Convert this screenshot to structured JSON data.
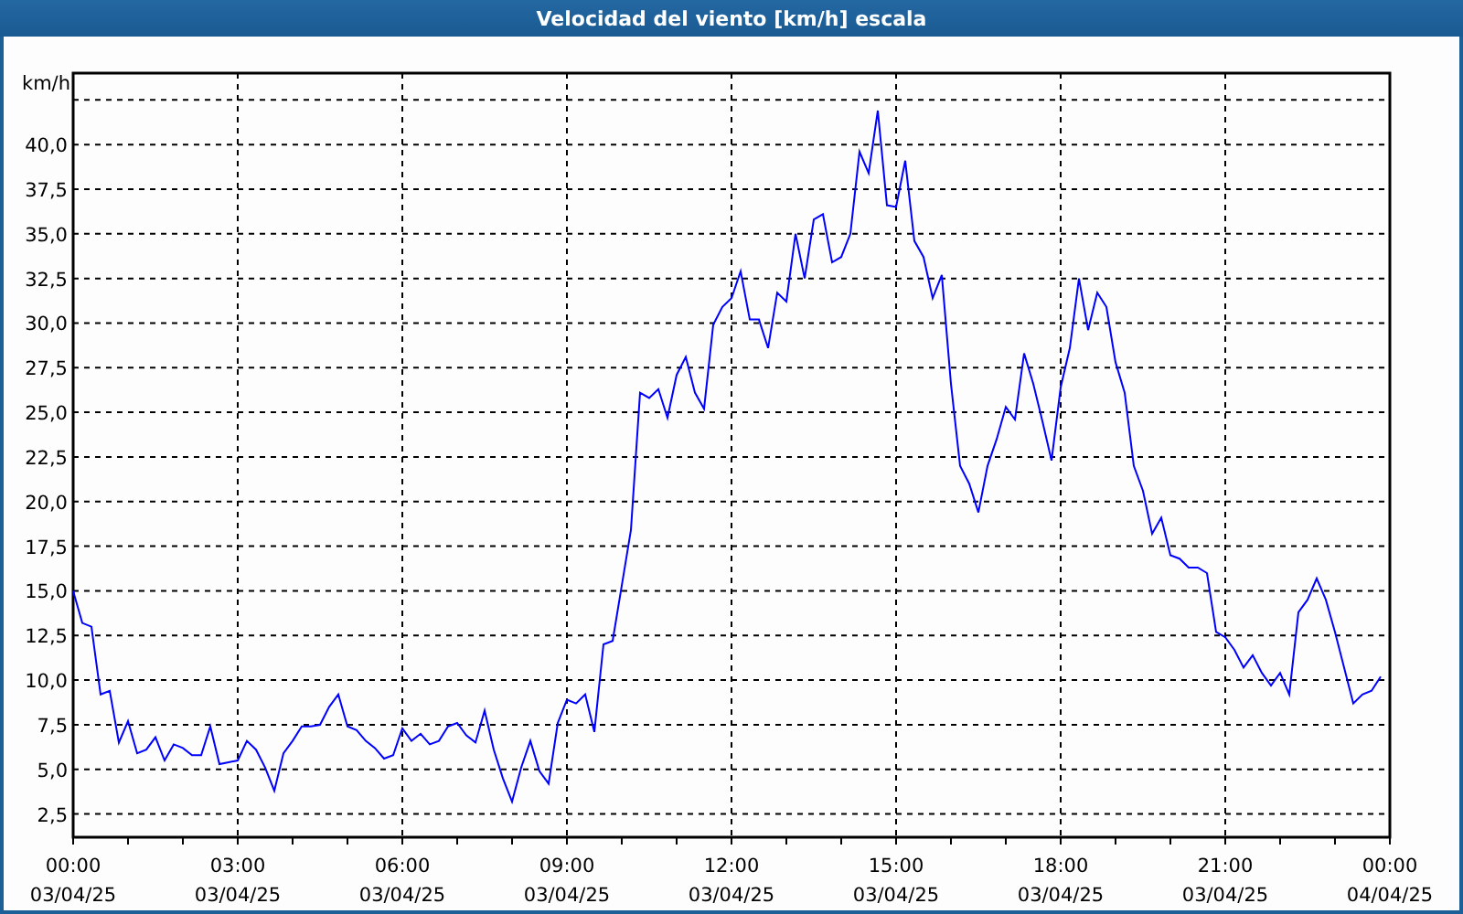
{
  "chart": {
    "chart_data": {
      "type": "line",
      "title": "Velocidad del viento [km/h] escala",
      "ylabel": "km/h",
      "grid": true,
      "ylim": [
        1.2,
        44
      ],
      "categories": [
        "00:00 03/04/25",
        null,
        null,
        null,
        null,
        null,
        null,
        null,
        null,
        null,
        null,
        null,
        null,
        null,
        null,
        null,
        null,
        null,
        "03:00 03/04/25",
        null,
        null,
        null,
        null,
        null,
        null,
        null,
        null,
        null,
        null,
        null,
        null,
        null,
        null,
        null,
        null,
        null,
        "06:00 03/04/25",
        null,
        null,
        null,
        null,
        null,
        null,
        null,
        null,
        null,
        null,
        null,
        null,
        null,
        null,
        null,
        null,
        null,
        "09:00 03/04/25",
        null,
        null,
        null,
        null,
        null,
        null,
        null,
        null,
        null,
        null,
        null,
        null,
        null,
        null,
        null,
        null,
        null,
        "12:00 03/04/25",
        null,
        null,
        null,
        null,
        null,
        null,
        null,
        null,
        null,
        null,
        null,
        null,
        null,
        null,
        null,
        null,
        null,
        "15:00 03/04/25",
        null,
        null,
        null,
        null,
        null,
        null,
        null,
        null,
        null,
        null,
        null,
        null,
        null,
        null,
        null,
        null,
        null,
        "18:00 03/04/25",
        null,
        null,
        null,
        null,
        null,
        null,
        null,
        null,
        null,
        null,
        null,
        null,
        null,
        null,
        null,
        null,
        null,
        "21:00 03/04/25",
        null,
        null,
        null,
        null,
        null,
        null,
        null,
        null,
        null,
        null,
        null,
        null,
        null,
        null,
        null,
        null,
        null,
        "00:00 04/04/25"
      ],
      "yticks": [
        {
          "value": 2.5,
          "label": "2,5"
        },
        {
          "value": 5,
          "label": "5,0"
        },
        {
          "value": 7.5,
          "label": "7,5"
        },
        {
          "value": 10,
          "label": "10,0"
        },
        {
          "value": 12.5,
          "label": "12,5"
        },
        {
          "value": 15,
          "label": "15,0"
        },
        {
          "value": 17.5,
          "label": "17,5"
        },
        {
          "value": 20,
          "label": "20,0"
        },
        {
          "value": 22.5,
          "label": "22,5"
        },
        {
          "value": 25,
          "label": "25,0"
        },
        {
          "value": 27.5,
          "label": "27,5"
        },
        {
          "value": 30,
          "label": "30,0"
        },
        {
          "value": 32.5,
          "label": "32,5"
        },
        {
          "value": 35,
          "label": "35,0"
        },
        {
          "value": 37.5,
          "label": "37,5"
        },
        {
          "value": 40,
          "label": "40,0"
        }
      ],
      "series": [
        {
          "color": "#0000ff",
          "values": [
            15.0,
            13.2,
            13.0,
            9.2,
            9.4,
            6.5,
            7.7,
            5.9,
            6.1,
            6.8,
            5.5,
            6.4,
            6.2,
            5.8,
            5.8,
            7.4,
            5.3,
            5.4,
            5.5,
            6.6,
            6.1,
            5.1,
            3.8,
            5.9,
            6.6,
            7.4,
            7.4,
            7.5,
            8.5,
            9.2,
            7.4,
            7.2,
            6.6,
            6.2,
            5.6,
            5.8,
            7.3,
            6.6,
            7.0,
            6.4,
            6.6,
            7.4,
            7.6,
            6.9,
            6.5,
            8.3,
            6.1,
            4.5,
            3.2,
            5.1,
            6.6,
            4.9,
            4.2,
            7.6,
            8.9,
            8.7,
            9.2,
            7.1,
            12.0,
            12.2,
            15.3,
            18.4,
            26.1,
            25.8,
            26.3,
            24.7,
            27.1,
            28.1,
            26.1,
            25.2,
            29.9,
            30.9,
            31.4,
            32.9,
            30.2,
            30.2,
            28.6,
            31.7,
            31.2,
            35.0,
            32.5,
            35.8,
            36.1,
            33.4,
            33.7,
            35.0,
            39.6,
            38.4,
            41.9,
            36.6,
            36.5,
            39.1,
            34.6,
            33.7,
            31.4,
            32.7,
            26.6,
            22.0,
            21.0,
            19.4,
            22.0,
            23.5,
            25.3,
            24.6,
            28.3,
            26.6,
            24.5,
            22.3,
            26.4,
            28.6,
            32.5,
            29.6,
            31.7,
            30.9,
            27.8,
            26.1,
            22.0,
            20.6,
            18.2,
            19.1,
            17.0,
            16.8,
            16.3,
            16.3,
            16.0,
            12.7,
            12.4,
            11.7,
            10.7,
            11.4,
            10.4,
            9.7,
            10.4,
            9.2,
            13.8,
            14.5,
            15.7,
            14.5,
            12.7,
            10.7,
            8.7,
            9.2,
            9.4,
            10.2,
            null
          ]
        }
      ]
    }
  }
}
